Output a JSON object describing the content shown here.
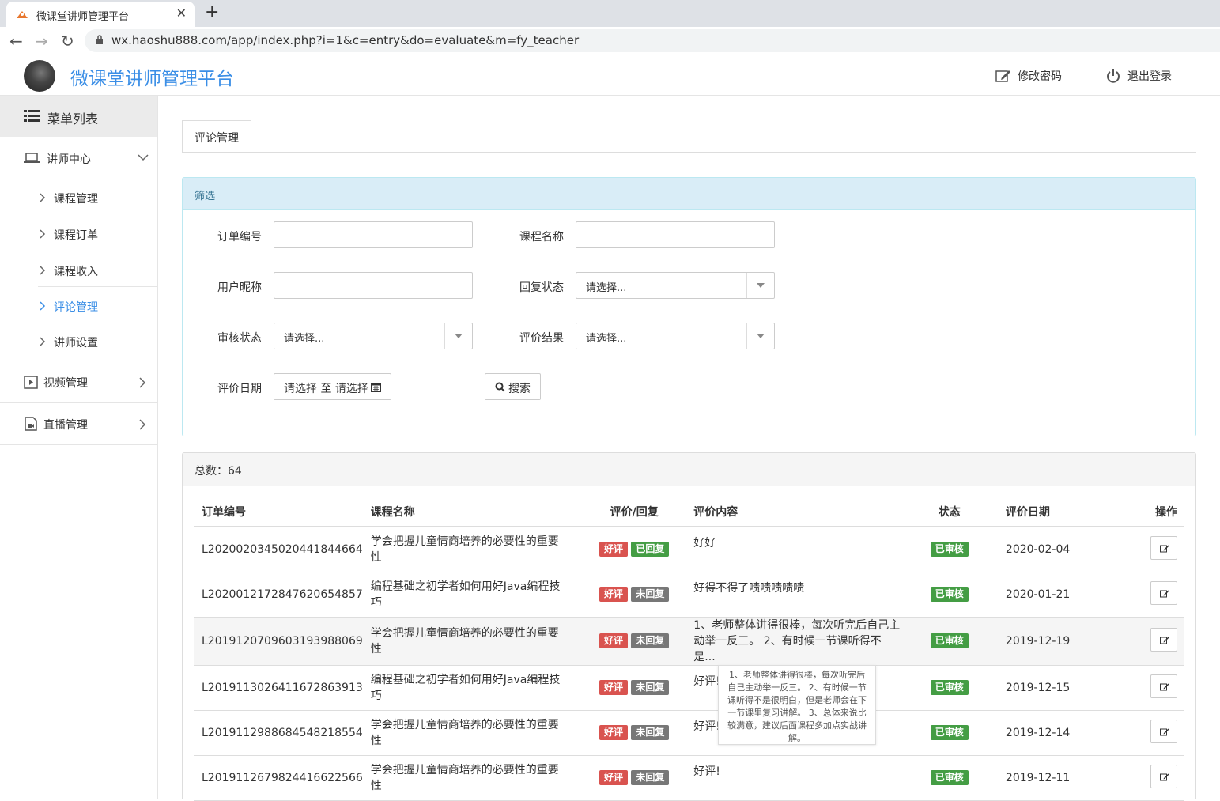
{
  "browser": {
    "tab_title": "微课堂讲师管理平台",
    "url": "wx.haoshu888.com/app/index.php?i=1&c=entry&do=evaluate&m=fy_teacher"
  },
  "header": {
    "brand": "微课堂讲师管理平台",
    "change_password": "修改密码",
    "logout": "退出登录"
  },
  "sidebar": {
    "menu_title": "菜单列表",
    "groups": [
      {
        "label": "讲师中心",
        "icon": "laptop-icon",
        "expanded": true,
        "items": [
          "课程管理",
          "课程订单",
          "课程收入",
          "评论管理",
          "讲师设置"
        ]
      },
      {
        "label": "视频管理",
        "icon": "video-icon",
        "expanded": false
      },
      {
        "label": "直播管理",
        "icon": "live-icon",
        "expanded": false
      }
    ],
    "active_item": "评论管理"
  },
  "main": {
    "tab": "评论管理",
    "filter": {
      "title": "筛选",
      "order_no_label": "订单编号",
      "course_name_label": "课程名称",
      "nickname_label": "用户昵称",
      "reply_status_label": "回复状态",
      "review_status_label": "审核状态",
      "eval_result_label": "评价结果",
      "eval_date_label": "评价日期",
      "select_placeholder": "请选择...",
      "date_range": "请选择 至 请选择",
      "search_button": "搜索"
    },
    "list": {
      "total": "总数：64",
      "columns": [
        "订单编号",
        "课程名称",
        "评价/回复",
        "评价内容",
        "状态",
        "评价日期",
        "操作"
      ],
      "rows": [
        {
          "order": "L202002034502044184466​4",
          "course_1": "学会把握儿童情商培养的必要性的重要",
          "course_2": "性",
          "grade": "好评",
          "reply": "已回复",
          "content_1": "好好",
          "content_2": "",
          "status": "已审核",
          "date": "2020-02-04"
        },
        {
          "order": "L202001217284762065485​7",
          "course_1": "编程基础之初学者如何用好Java编程技",
          "course_2": "巧",
          "grade": "好评",
          "reply": "未回复",
          "content_1": "好得不得了啧啧啧啧啧",
          "content_2": "",
          "status": "已审核",
          "date": "2020-01-21"
        },
        {
          "order": "L201912070960319398806​9",
          "course_1": "学会把握儿童情商培养的必要性的重要",
          "course_2": "性",
          "grade": "好评",
          "reply": "未回复",
          "content_1": "1、老师整体讲得很棒，每次听完后自己主",
          "content_2": "动举一反三。 2、有时候一节课听得不是...",
          "status": "已审核",
          "date": "2019-12-19"
        },
        {
          "order": "L201911302641167286391​3",
          "course_1": "编程基础之初学者如何用好Java编程技",
          "course_2": "巧",
          "grade": "好评",
          "reply": "未回复",
          "content_1": "好评!",
          "content_2": "",
          "status": "已审核",
          "date": "2019-12-15"
        },
        {
          "order": "L201911298868454821855​4",
          "course_1": "学会把握儿童情商培养的必要性的重要",
          "course_2": "性",
          "grade": "好评",
          "reply": "未回复",
          "content_1": "好评!",
          "content_2": "",
          "status": "已审核",
          "date": "2019-12-14"
        },
        {
          "order": "L201911267982441662256​6",
          "course_1": "学会把握儿童情商培养的必要性的重要",
          "course_2": "性",
          "grade": "好评",
          "reply": "未回复",
          "content_1": "好评!",
          "content_2": "",
          "status": "已审核",
          "date": "2019-12-11"
        }
      ]
    },
    "tooltip": "1、老师整体讲得很棒，每次听完后自己主动举一反三。 2、有时候一节课听得不是很明白，但是老师会在下一节课里复习讲解。 3、总体来说比较满意，建议后面课程多加点实战讲解。"
  },
  "colors": {
    "brand": "#3a8ee6",
    "danger": "#d9534f",
    "success": "#449d44",
    "muted": "#777777",
    "filter_head": "#d9edf7"
  }
}
